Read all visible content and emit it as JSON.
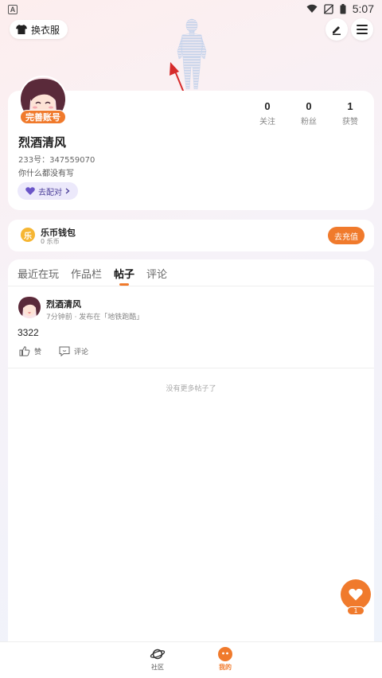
{
  "status_bar": {
    "left_badge": "A",
    "time": "5:07"
  },
  "header": {
    "outfit_label": "换衣服"
  },
  "profile": {
    "badge": "完善账号",
    "username": "烈酒清风",
    "user_id": "233号：347559070",
    "bio": "你什么都没有写",
    "match_label": "去配对",
    "stats": [
      {
        "value": "0",
        "label": "关注"
      },
      {
        "value": "0",
        "label": "粉丝"
      },
      {
        "value": "1",
        "label": "获赞"
      }
    ]
  },
  "wallet": {
    "icon_char": "乐",
    "title": "乐币钱包",
    "balance": "0 乐币",
    "recharge_label": "去充值"
  },
  "tabs": [
    "最近在玩",
    "作品栏",
    "帖子",
    "评论"
  ],
  "active_tab": 2,
  "post": {
    "author": "烈酒清风",
    "meta": "7分钟前 · 发布在「地铁跑酷」",
    "content": "3322",
    "like_label": "赞",
    "comment_label": "评论"
  },
  "no_more": "没有更多帖子了",
  "fab": {
    "count": "1"
  },
  "bottom_nav": [
    {
      "label": "社区",
      "icon": "planet-icon"
    },
    {
      "label": "我的",
      "icon": "face-icon"
    }
  ],
  "colors": {
    "accent": "#f07a2c",
    "annotation_arrow": "#d62b2b"
  }
}
